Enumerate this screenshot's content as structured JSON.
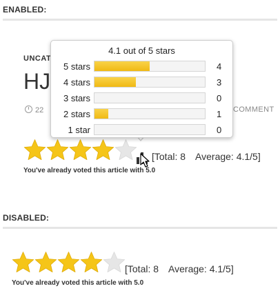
{
  "enabled_section": {
    "label": "ENABLED:",
    "post": {
      "category": "UNCAT",
      "title": "HJ",
      "date": "22",
      "comment": "COMMENT"
    },
    "rating": {
      "filled_stars": 4,
      "total_stars": 5,
      "total_text": "[Total: 8",
      "average_text": "Average: 4.1/5]",
      "voted_text": "You've already voted this article with 5.0"
    },
    "tooltip": {
      "title": "4.1 out of 5 stars",
      "rows": [
        {
          "label": "5 stars",
          "count": "4",
          "fraction": 0.5
        },
        {
          "label": "4 stars",
          "count": "3",
          "fraction": 0.375
        },
        {
          "label": "3 stars",
          "count": "0",
          "fraction": 0
        },
        {
          "label": "2 stars",
          "count": "1",
          "fraction": 0.125
        },
        {
          "label": "1 star",
          "count": "0",
          "fraction": 0
        }
      ]
    }
  },
  "disabled_section": {
    "label": "DISABLED:",
    "rating": {
      "filled_stars": 4,
      "total_stars": 5,
      "total_text": "[Total: 8",
      "average_text": "Average: 4.1/5]",
      "voted_text": "You've already voted this article with 5.0"
    }
  },
  "colors": {
    "star_fill": "#f5c518",
    "star_empty": "#e6e6e6",
    "bar_fill": "#f0b914"
  },
  "icons": {
    "chart": "bar-chart-icon",
    "cursor": "pointer-cursor-icon",
    "clock": "clock-icon"
  }
}
